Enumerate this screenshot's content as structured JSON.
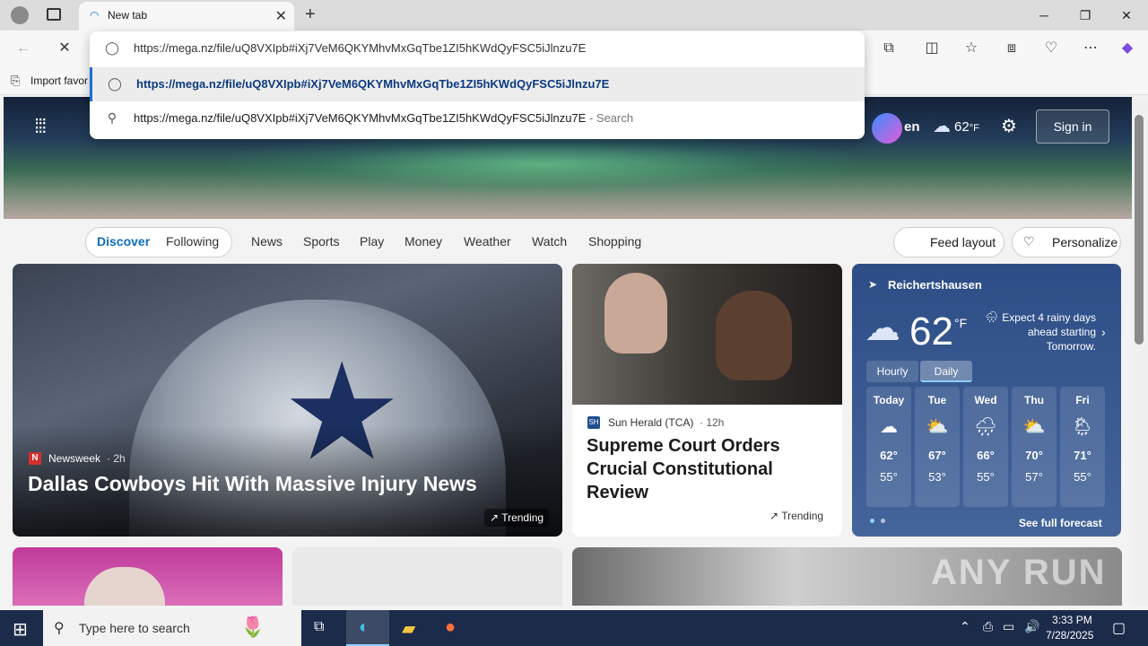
{
  "browser": {
    "tab_title": "New tab",
    "favorites_bar_text": "Import favor",
    "omnibox": {
      "input_value": "https://mega.nz/file/uQ8VXIpb#iXj7VeM6QKYMhvMxGqTbe1ZI5hKWdQyFSC5iJlnzu7E",
      "suggestion_1": "https://mega.nz/file/uQ8VXIpb#iXj7VeM6QKYMhvMxGqTbe1ZI5hKWdQyFSC5iJlnzu7E",
      "suggestion_2": "https://mega.nz/file/uQ8VXIpb#iXj7VeM6QKYMhvMxGqTbe1ZI5hKWdQyFSC5iJlnzu7E",
      "suggestion_2_suffix": "- Search"
    }
  },
  "header": {
    "copilot_partial": "en",
    "temp": "62",
    "temp_unit": "°F",
    "sign_in": "Sign in"
  },
  "nav": {
    "discover": "Discover",
    "following": "Following",
    "links": [
      "News",
      "Sports",
      "Play",
      "Money",
      "Weather",
      "Watch",
      "Shopping"
    ],
    "feed_layout": "Feed layout",
    "personalize": "Personalize"
  },
  "cards": {
    "main": {
      "source": "Newsweek",
      "time": "· 2h",
      "headline": "Dallas Cowboys Hit With Massive Injury News",
      "badge": "Trending"
    },
    "second": {
      "source": "Sun Herald (TCA)",
      "time": "· 12h",
      "headline": "Supreme Court Orders Crucial Constitutional Review",
      "badge": "Trending"
    }
  },
  "weather": {
    "location": "Reichertshausen",
    "temp": "62",
    "unit": "°F",
    "message": "Expect 4 rainy days ahead starting Tomorrow.",
    "tab_hourly": "Hourly",
    "tab_daily": "Daily",
    "days": [
      {
        "name": "Today",
        "high": "62°",
        "low": "55°",
        "icon": "☁"
      },
      {
        "name": "Tue",
        "high": "67°",
        "low": "53°",
        "icon": "⛅"
      },
      {
        "name": "Wed",
        "high": "66°",
        "low": "55°",
        "icon": "🌧"
      },
      {
        "name": "Thu",
        "high": "70°",
        "low": "57°",
        "icon": "⛅"
      },
      {
        "name": "Fri",
        "high": "71°",
        "low": "55°",
        "icon": "🌦"
      }
    ],
    "see_full": "See full forecast"
  },
  "taskbar": {
    "search_placeholder": "Type here to search",
    "time": "3:33 PM",
    "date": "7/28/2025"
  },
  "watermark": "ANY RUN"
}
